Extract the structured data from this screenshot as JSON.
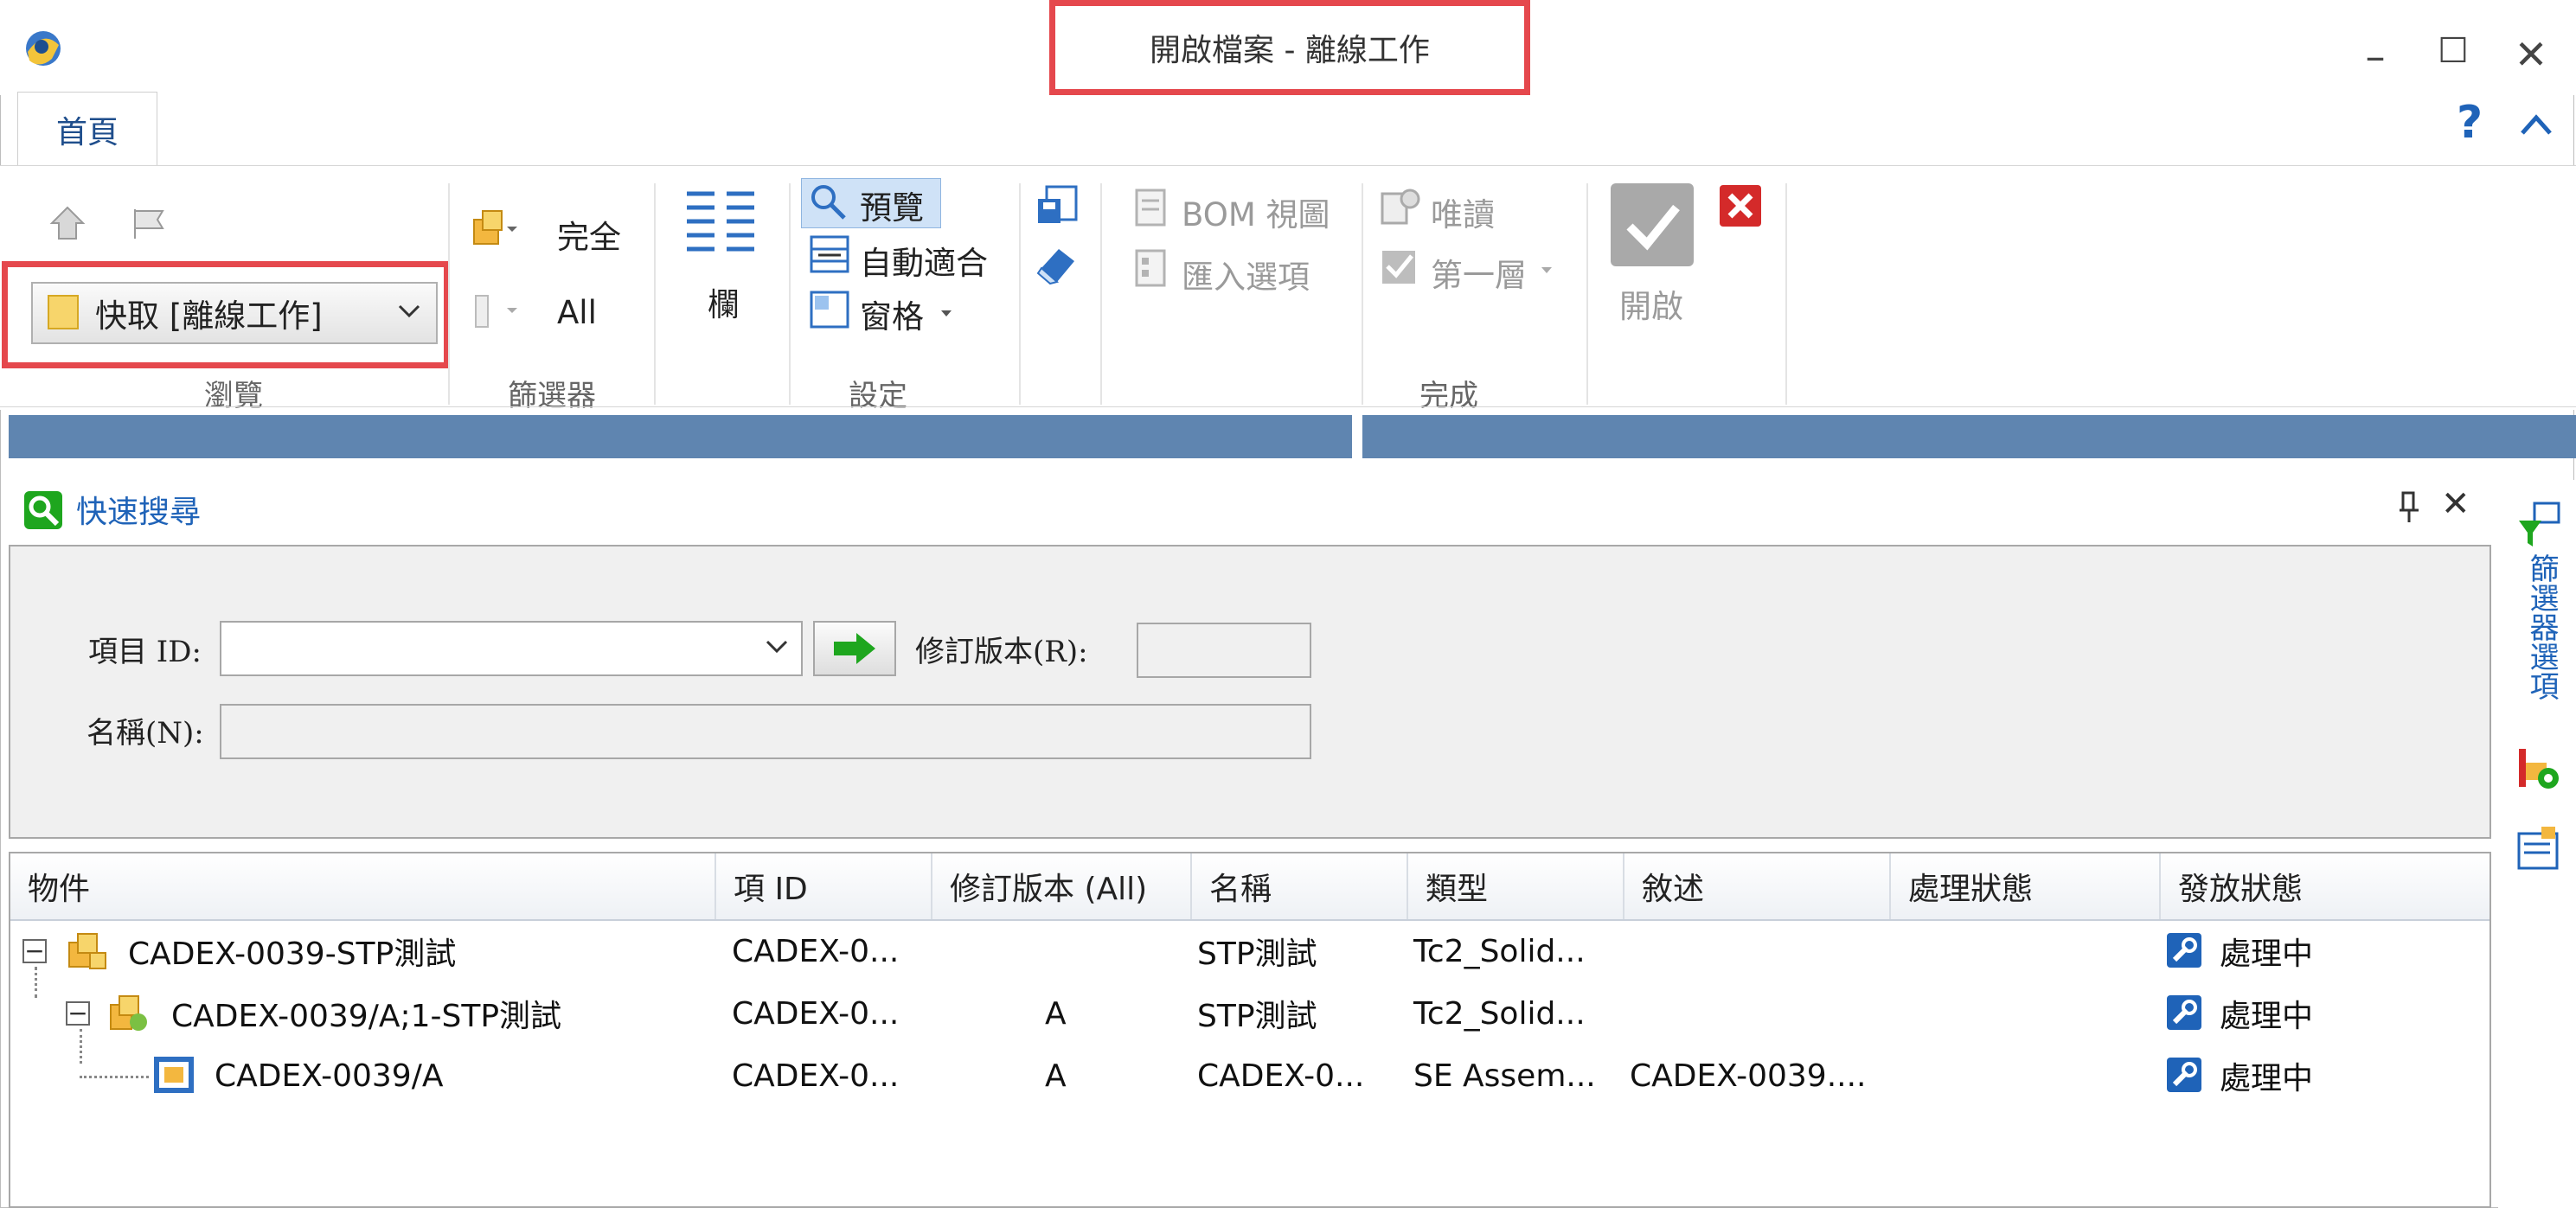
{
  "window": {
    "title": "開啟檔案 - 離線工作",
    "controls": {
      "minimize": "–",
      "maximize": "☐",
      "close": "✕"
    }
  },
  "tabs": [
    {
      "label": "首頁"
    }
  ],
  "help": {
    "question": "?",
    "collapse": "^"
  },
  "ribbon": {
    "browse": {
      "group_label": "瀏覽",
      "cache_select": "快取 [離線工作]"
    },
    "filter": {
      "group_label": "篩選器",
      "complete_label": "完全",
      "all_label": "All"
    },
    "columns": {
      "label": "欄"
    },
    "settings": {
      "group_label": "設定",
      "preview_label": "預覽",
      "auto_fit_label": "自動適合",
      "pane_label": "窗格"
    },
    "done": {
      "group_label": "完成",
      "bom_view_label": "BOM 視圖",
      "import_options_label": "匯入選項",
      "read_only_label": "唯讀",
      "first_level_label": "第一層",
      "open_label": "開啟"
    }
  },
  "quick_search": {
    "title": "快速搜尋",
    "item_id_label": "項目 ID:",
    "item_id_value": "",
    "revision_label": "修訂版本(R):",
    "revision_value": "",
    "name_label": "名稱(N):",
    "name_value": "",
    "pin": "ᛘ",
    "close": "✕"
  },
  "side_panel": {
    "filter_options_label": "篩選器選項"
  },
  "table": {
    "columns": [
      "物件",
      "項 ID",
      "修訂版本 (All)",
      "名稱",
      "類型",
      "敘述",
      "處理狀態",
      "發放狀態"
    ],
    "rows": [
      {
        "object": "CADEX-0039-STP測試",
        "item_id": "CADEX-0...",
        "revision": "",
        "name": "STP測試",
        "type": "Tc2_Solid...",
        "description": "",
        "process_status": "",
        "release_status": "處理中"
      },
      {
        "object": "CADEX-0039/A;1-STP測試",
        "item_id": "CADEX-0...",
        "revision": "A",
        "name": "STP測試",
        "type": "Tc2_Solid...",
        "description": "",
        "process_status": "",
        "release_status": "處理中"
      },
      {
        "object": "CADEX-0039/A",
        "item_id": "CADEX-0...",
        "revision": "A",
        "name": "CADEX-0...",
        "type": "SE Assem...",
        "description": "CADEX-0039....",
        "process_status": "",
        "release_status": "處理中"
      }
    ]
  },
  "colors": {
    "accent_blue": "#1f63b8",
    "highlight_red": "#e5484d",
    "bluebar": "#5f85b0",
    "go_green": "#1ea61e"
  }
}
